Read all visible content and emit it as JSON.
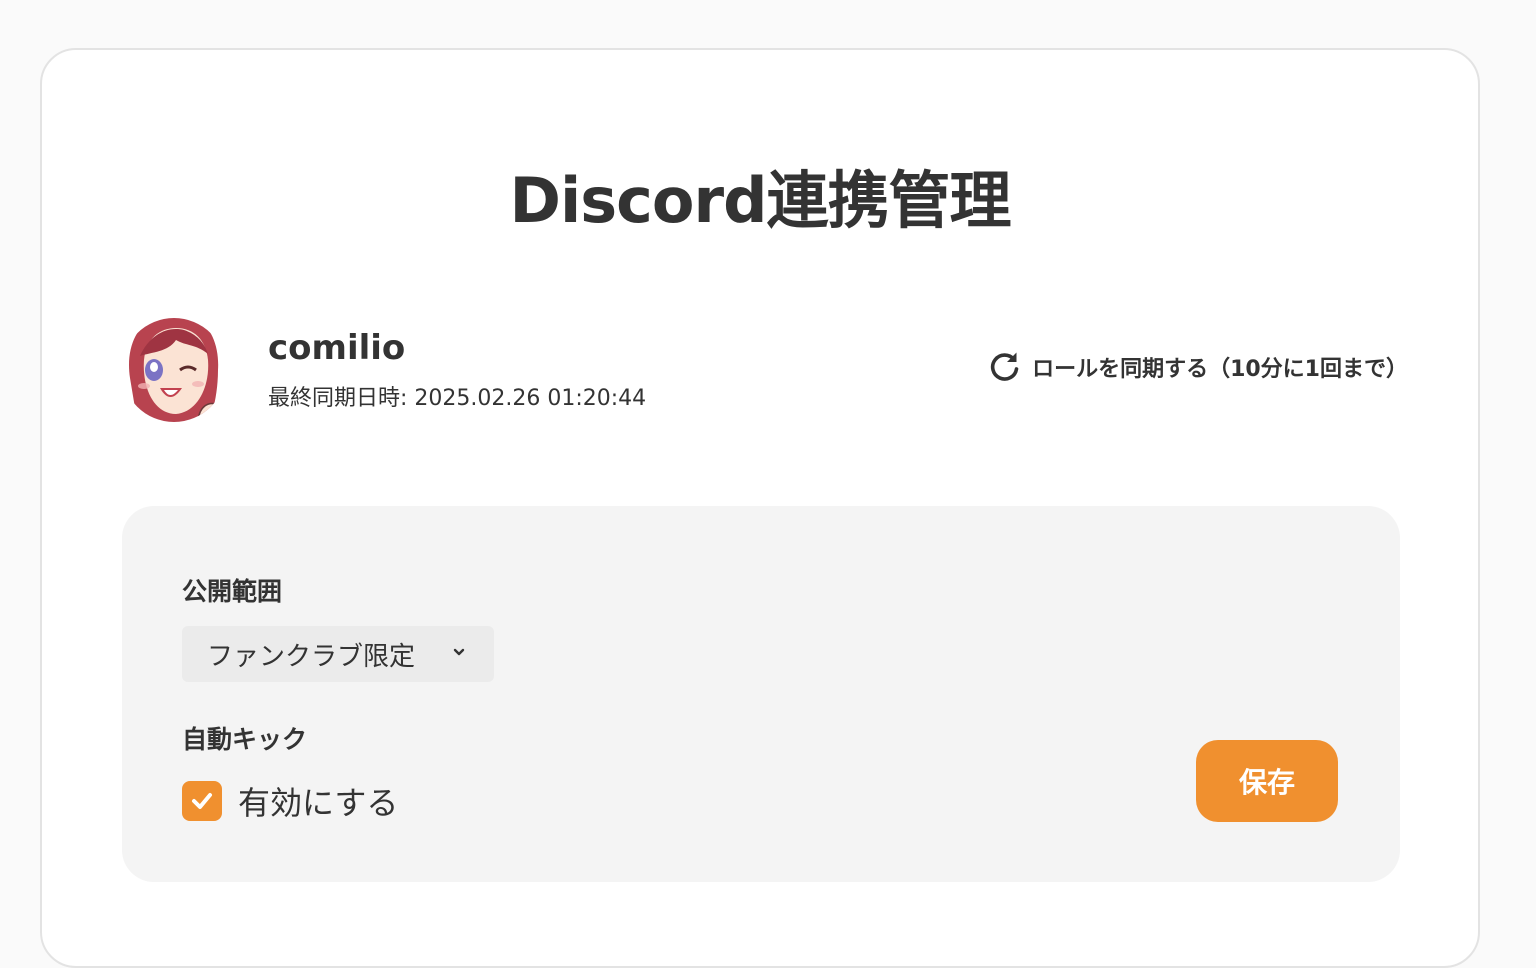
{
  "page": {
    "title": "Discord連携管理"
  },
  "profile": {
    "username": "comilio",
    "last_sync": "最終同期日時: 2025.02.26 01:20:44",
    "sync_button_label": "ロールを同期する（10分に1回まで）",
    "sync_icon": "refresh-icon"
  },
  "settings": {
    "visibility_label": "公開範囲",
    "visibility_value": "ファンクラブ限定",
    "auto_kick_label": "自動キック",
    "auto_kick_checkbox_label": "有効にする",
    "auto_kick_enabled": true,
    "save_label": "保存"
  },
  "colors": {
    "accent": "#f0902f",
    "text": "#333333",
    "panel_bg": "#f4f4f4",
    "select_bg": "#ebebeb"
  }
}
